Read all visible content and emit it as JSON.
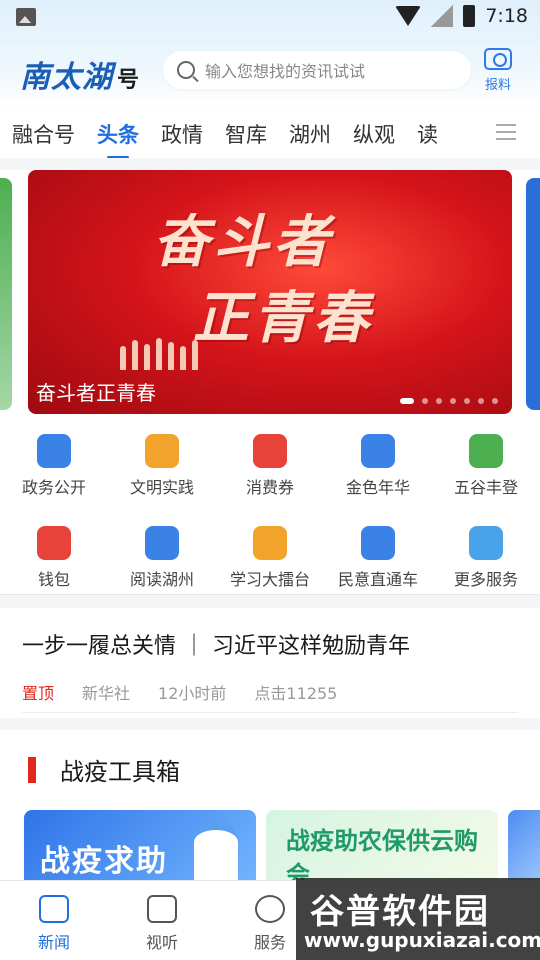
{
  "status": {
    "time": "7:18"
  },
  "header": {
    "logo_text": "南太湖",
    "logo_suffix": "号",
    "search_placeholder": "输入您想找的资讯试试",
    "report_label": "报料"
  },
  "tabs": [
    {
      "label": "融合号",
      "active": false
    },
    {
      "label": "头条",
      "active": true
    },
    {
      "label": "政情",
      "active": false
    },
    {
      "label": "智库",
      "active": false
    },
    {
      "label": "湖州",
      "active": false
    },
    {
      "label": "纵观",
      "active": false
    },
    {
      "label": "读",
      "active": false
    }
  ],
  "banner": {
    "art_line1": "奋斗者",
    "art_line2": "正青春",
    "caption": "奋斗者正青春",
    "page_count": 7,
    "current_page": 1
  },
  "services": [
    {
      "label": "政务公开",
      "icon": "government-icon",
      "color": "#3b82e6"
    },
    {
      "label": "文明实践",
      "icon": "civilization-icon",
      "color": "#f2a32b"
    },
    {
      "label": "消费券",
      "icon": "coupon-icon",
      "color": "#e8433a"
    },
    {
      "label": "金色年华",
      "icon": "microphone-icon",
      "color": "#3b82e6"
    },
    {
      "label": "五谷丰登",
      "icon": "mountain-icon",
      "color": "#4caf50"
    },
    {
      "label": "钱包",
      "icon": "wallet-icon",
      "color": "#e8433a"
    },
    {
      "label": "阅读湖州",
      "icon": "book-icon",
      "color": "#3b82e6"
    },
    {
      "label": "学习大擂台",
      "icon": "study-icon",
      "color": "#f2a32b"
    },
    {
      "label": "民意直通车",
      "icon": "mail-icon",
      "color": "#3b82e6"
    },
    {
      "label": "更多服务",
      "icon": "more-icon",
      "color": "#4aa3e8"
    }
  ],
  "headline": {
    "title": "一步一履总关情 ｜ 习近平这样勉励青年",
    "tag": "置顶",
    "source": "新华社",
    "time": "12小时前",
    "clicks": "点击11255"
  },
  "section": {
    "title": "战疫工具箱"
  },
  "cards": [
    {
      "label": "战疫求助"
    },
    {
      "label": "战疫助农保供云购会"
    }
  ],
  "nav": [
    {
      "label": "新闻",
      "icon": "news-icon",
      "active": true
    },
    {
      "label": "视听",
      "icon": "tv-icon",
      "active": false
    },
    {
      "label": "服务",
      "icon": "service-icon",
      "active": false
    }
  ],
  "watermark": {
    "line1": "谷普软件园",
    "line2": "www.gupuxiazai.com"
  }
}
